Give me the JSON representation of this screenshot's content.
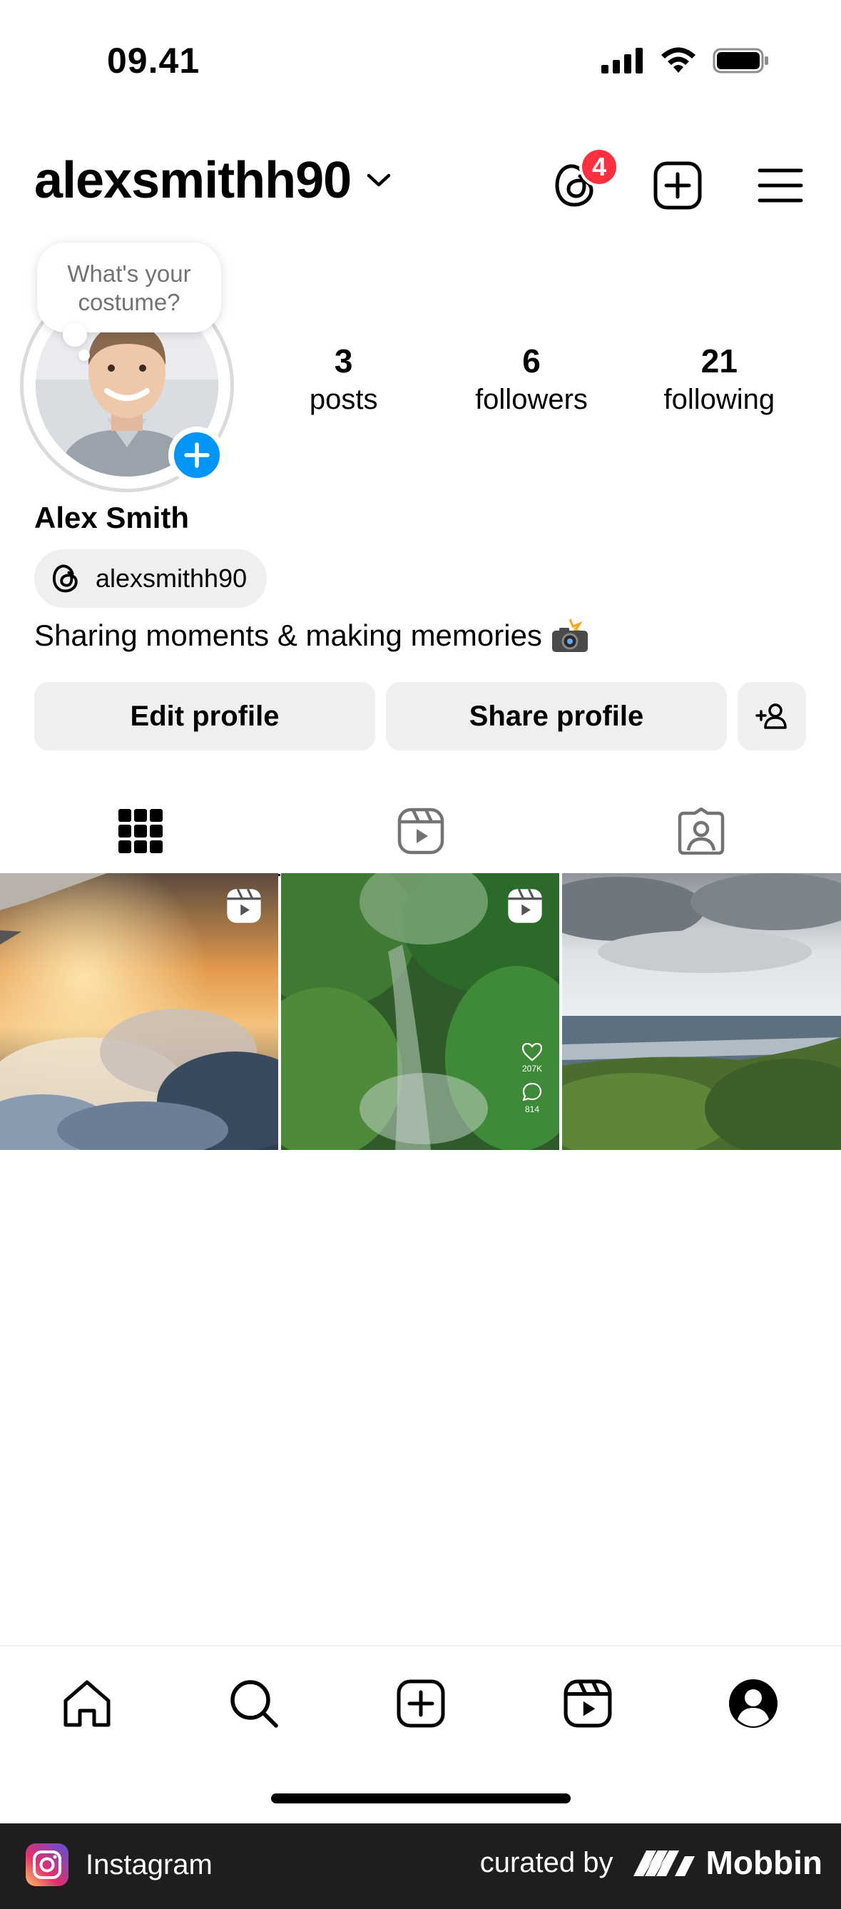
{
  "status_bar": {
    "time": "09.41"
  },
  "header": {
    "username": "alexsmithh90",
    "threads_badge_count": "4"
  },
  "profile": {
    "note": "What's your costume?",
    "stats": [
      {
        "value": "3",
        "label": "posts"
      },
      {
        "value": "6",
        "label": "followers"
      },
      {
        "value": "21",
        "label": "following"
      }
    ],
    "full_name": "Alex Smith",
    "threads_handle": "alexsmithh90",
    "bio": "Sharing moments & making memories",
    "bio_emoji": "camera-flash-icon"
  },
  "buttons": {
    "edit_profile": "Edit profile",
    "share_profile": "Share profile"
  },
  "tabs": [
    {
      "name": "grid-icon",
      "active": true
    },
    {
      "name": "reels-icon",
      "active": false
    },
    {
      "name": "tagged-icon",
      "active": false
    }
  ],
  "posts": [
    {
      "type": "reel",
      "scene": "sunset clouds from airplane"
    },
    {
      "type": "reel",
      "scene": "jungle waterfall",
      "likes": "207K",
      "comments": "814"
    },
    {
      "type": "photo",
      "scene": "green coastline"
    }
  ],
  "bottom_nav": [
    "home-icon",
    "search-icon",
    "create-icon",
    "reels-icon",
    "profile-icon"
  ],
  "footer": {
    "app_name": "Instagram",
    "curated_by": "curated by",
    "brand": "Mobbin"
  },
  "colors": {
    "accent_blue": "#0095f6",
    "badge_red": "#ff3040",
    "button_bg": "#efefef",
    "footer_bg": "#1e1e1e"
  }
}
